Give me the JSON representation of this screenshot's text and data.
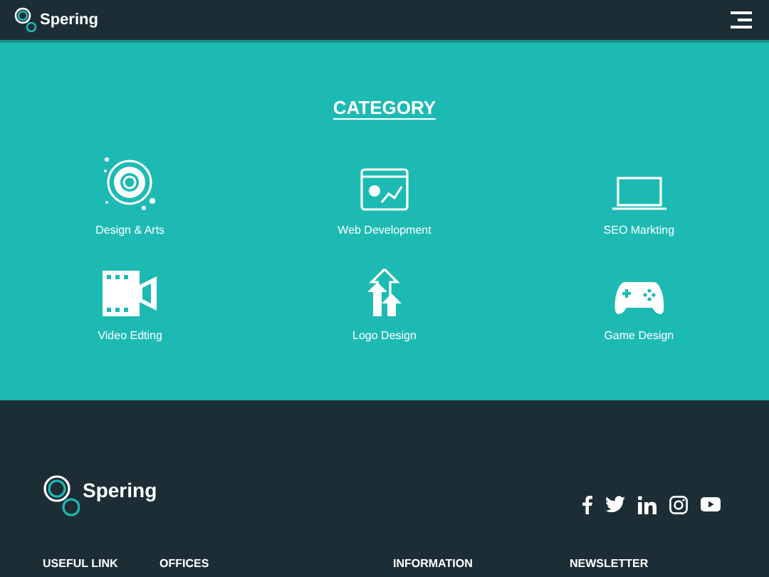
{
  "header": {
    "brand": "Spering"
  },
  "category_section": {
    "title": "CATEGORY",
    "items": [
      {
        "kind": "design",
        "label": "Design & Arts"
      },
      {
        "kind": "web",
        "label": "Web Development"
      },
      {
        "kind": "laptop",
        "label": "SEO Markting"
      },
      {
        "kind": "video",
        "label": "Video Edting"
      },
      {
        "kind": "logo",
        "label": "Logo Design"
      },
      {
        "kind": "game",
        "label": "Game Design"
      }
    ]
  },
  "footer": {
    "brand": "Spering",
    "social": [
      {
        "kind": "facebook"
      },
      {
        "kind": "twitter"
      },
      {
        "kind": "linkedin"
      },
      {
        "kind": "instagram"
      },
      {
        "kind": "youtube"
      }
    ],
    "headings": [
      "USEFUL LINK",
      "OFFICES",
      "INFORMATION",
      "NEWSLETTER"
    ]
  }
}
